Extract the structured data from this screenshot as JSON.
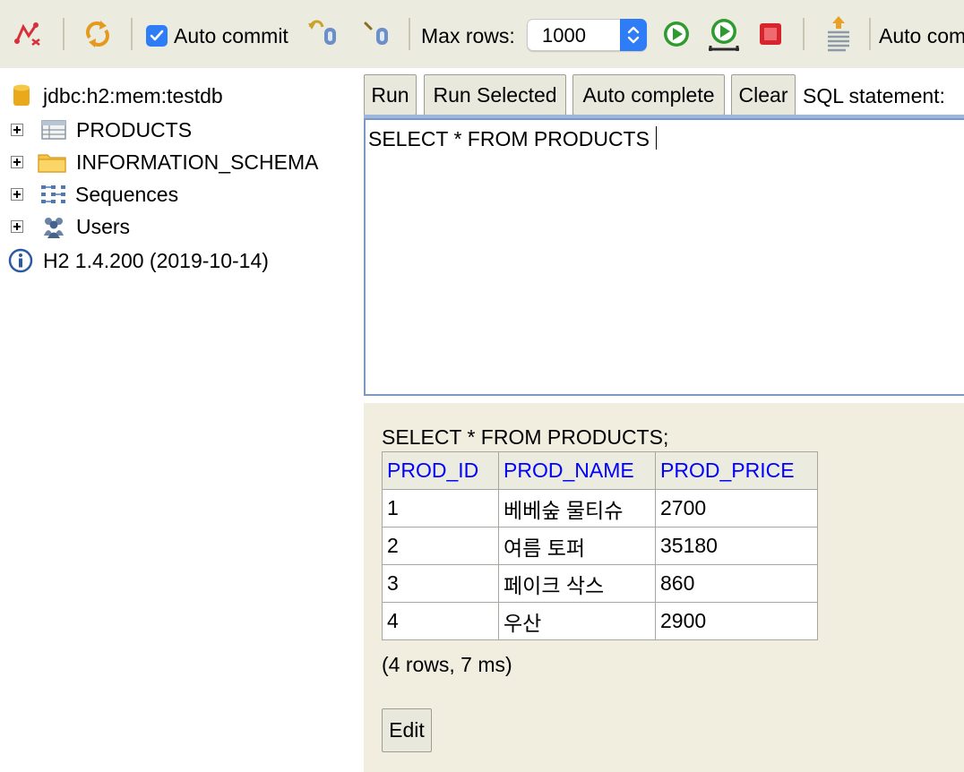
{
  "toolbar": {
    "auto_commit_label": "Auto commit",
    "auto_commit_checked": true,
    "max_rows_label": "Max rows:",
    "max_rows_value": "1000",
    "auto_complete_label": "Auto com"
  },
  "tree": {
    "connection": "jdbc:h2:mem:testdb",
    "items": [
      {
        "label": "PRODUCTS",
        "icon": "table-icon"
      },
      {
        "label": "INFORMATION_SCHEMA",
        "icon": "folder-icon"
      },
      {
        "label": "Sequences",
        "icon": "sequences-icon"
      },
      {
        "label": "Users",
        "icon": "users-icon"
      }
    ],
    "version": "H2 1.4.200 (2019-10-14)"
  },
  "buttons": {
    "run": "Run",
    "run_selected": "Run Selected",
    "auto_complete": "Auto complete",
    "clear": "Clear",
    "sql_statement_label": "SQL statement:"
  },
  "editor": {
    "text": "SELECT * FROM PRODUCTS"
  },
  "results": {
    "query": "SELECT * FROM PRODUCTS;",
    "columns": [
      "PROD_ID",
      "PROD_NAME",
      "PROD_PRICE"
    ],
    "rows": [
      [
        "1",
        "베베숲 물티슈",
        "2700"
      ],
      [
        "2",
        "여름 토퍼",
        "35180"
      ],
      [
        "3",
        "페이크 삭스",
        "860"
      ],
      [
        "4",
        "우산",
        "2900"
      ]
    ],
    "summary": "(4 rows, 7 ms)",
    "edit_label": "Edit"
  },
  "colors": {
    "toolbar_bg": "#ecebdf",
    "results_bg": "#f1eee0",
    "header_text": "#0000ff",
    "accent": "#2e7cf6"
  }
}
